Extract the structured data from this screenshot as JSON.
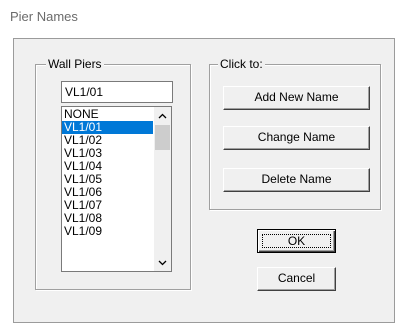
{
  "window": {
    "title": "Pier Names"
  },
  "wall_piers": {
    "legend": "Wall Piers",
    "current_value": "VL1/01",
    "items": [
      "NONE",
      "VL1/01",
      "VL1/02",
      "VL1/03",
      "VL1/04",
      "VL1/05",
      "VL1/06",
      "VL1/07",
      "VL1/08",
      "VL1/09"
    ],
    "selected_index": 1,
    "scroll_position_fraction": 0.0
  },
  "click_to": {
    "legend": "Click to:",
    "add_label": "Add New Name",
    "change_label": "Change Name",
    "delete_label": "Delete Name"
  },
  "dialog_buttons": {
    "ok_label": "OK",
    "cancel_label": "Cancel"
  },
  "colors": {
    "selection": "#0078d7",
    "dialog_background": "#f0f0f0"
  },
  "icons": {
    "scroll_up": "chevron-up-icon",
    "scroll_down": "chevron-down-icon"
  }
}
